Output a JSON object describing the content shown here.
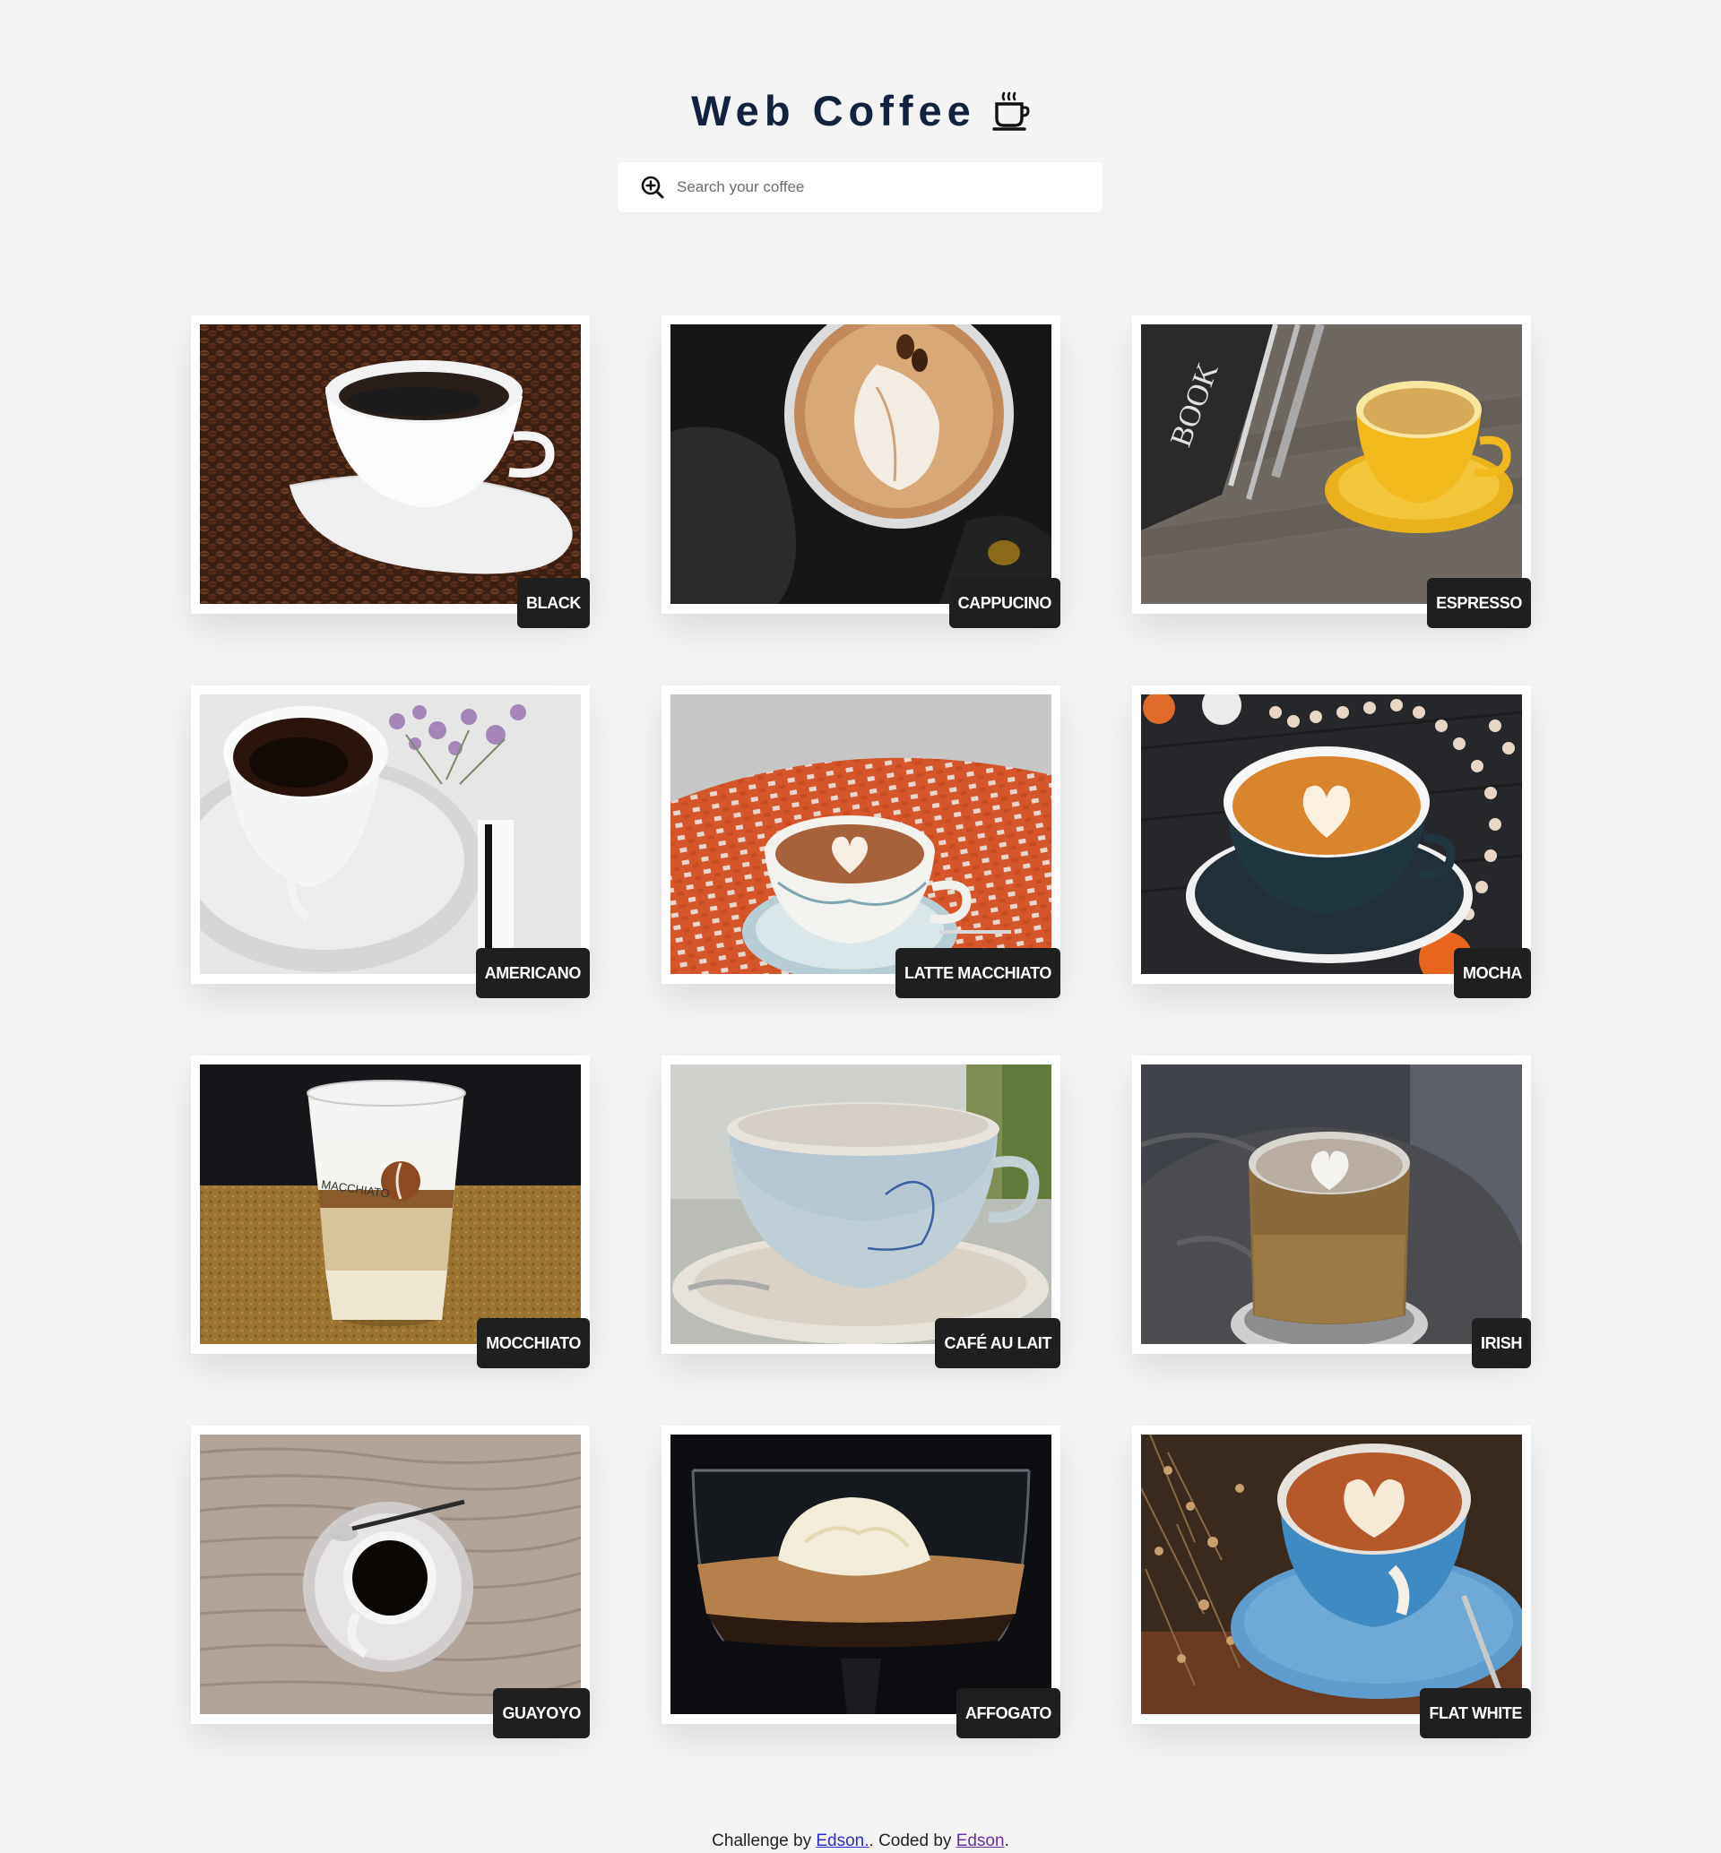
{
  "header": {
    "title": "Web Coffee",
    "title_icon": "coffee-cup-icon"
  },
  "search": {
    "placeholder": "Search your coffee",
    "value": "",
    "icon": "zoom-in-magnifier-icon"
  },
  "coffees": [
    {
      "name": "BLACK",
      "scene": "black"
    },
    {
      "name": "CAPPUCINO",
      "scene": "cappucino"
    },
    {
      "name": "ESPRESSO",
      "scene": "espresso"
    },
    {
      "name": "AMERICANO",
      "scene": "americano"
    },
    {
      "name": "LATTE MACCHIATO",
      "scene": "latte"
    },
    {
      "name": "MOCHA",
      "scene": "mocha"
    },
    {
      "name": "MOCCHIATO",
      "scene": "mocchiato"
    },
    {
      "name": "CAFÉ AU LAIT",
      "scene": "aulait"
    },
    {
      "name": "IRISH",
      "scene": "irish"
    },
    {
      "name": "GUAYOYO",
      "scene": "guayoyo"
    },
    {
      "name": "AFFOGATO",
      "scene": "affogato"
    },
    {
      "name": "FLAT WHITE",
      "scene": "flatwhite"
    }
  ],
  "photo_labels": {
    "mocchiato_glass_text": "MACCHIATO",
    "espresso_book_text": "BOOK"
  },
  "footer": {
    "prefix": "Challenge by ",
    "challenge_author": "Edson.",
    "middle": ". Coded by ",
    "coder": "Edson",
    "suffix": "."
  }
}
